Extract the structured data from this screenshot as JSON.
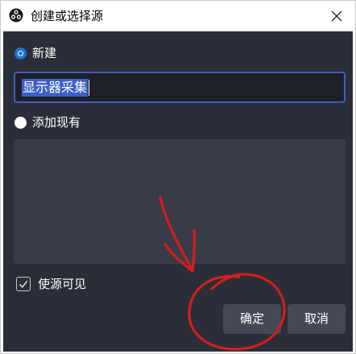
{
  "window": {
    "title": "创建或选择源",
    "icon": "obs-logo-icon",
    "close_icon": "close-icon"
  },
  "options": {
    "create_new_label": "新建",
    "create_new_selected": true,
    "add_existing_label": "添加现有",
    "add_existing_selected": false
  },
  "name_input": {
    "value": "显示器采集"
  },
  "visible_checkbox": {
    "label": "使源可见",
    "checked": true
  },
  "buttons": {
    "ok_label": "确定",
    "cancel_label": "取消"
  },
  "colors": {
    "background": "#2b2e38",
    "accent": "#1f6fd1",
    "annotation": "#d21e1e"
  }
}
